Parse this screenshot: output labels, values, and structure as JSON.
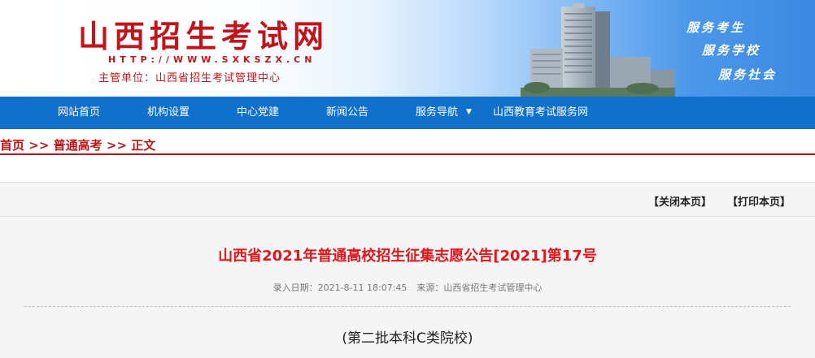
{
  "header": {
    "title": "山西招生考试网",
    "url": "HTTP://WWW.SXKSZX.CN",
    "admin": "主管单位：山西省招生考试管理中心",
    "slogans": [
      "服务考生",
      "服务学校",
      "服务社会"
    ]
  },
  "nav": {
    "items": [
      {
        "label": "网站首页"
      },
      {
        "label": "机构设置"
      },
      {
        "label": "中心党建"
      },
      {
        "label": "新闻公告"
      },
      {
        "label": "服务导航"
      },
      {
        "label": "山西教育考试服务网"
      }
    ],
    "caret": "▼"
  },
  "breadcrumb": {
    "home": "首页",
    "sep": ">>",
    "category": "普通高考",
    "current": "正文"
  },
  "toolbar": {
    "close_label": "【关闭本页】",
    "print_label": "【打印本页】"
  },
  "article": {
    "title": "山西省2021年普通高校招生征集志愿公告[2021]第17号",
    "date": "录入日期：2021-8-11 18:07:45",
    "source": "来源：山西省招生考试管理中心",
    "body_first_line": "(第二批本科C类院校)"
  },
  "colors": {
    "brand_red": "#c0161b",
    "nav_blue": "#1070cc",
    "title_red": "#e0171d"
  }
}
